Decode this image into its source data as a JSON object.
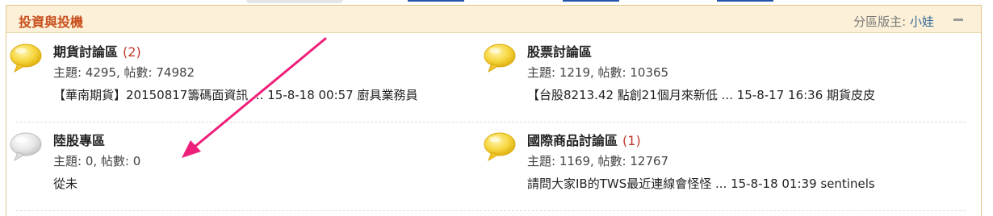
{
  "section": {
    "title": "投資與投機",
    "moderator_label": "分區版主:",
    "moderator_name": "小娃"
  },
  "forums": [
    {
      "name": "期貨討論區",
      "new_count": "(2)",
      "stats": "主題: 4295, 帖數: 74982",
      "last_post": "【華南期貨】20150817籌碼面資訊 ... 15-8-18 00:57 廚具業務員",
      "icon": "speech-bubble-new-icon"
    },
    {
      "name": "股票討論區",
      "new_count": "",
      "stats": "主題: 1219, 帖數: 10365",
      "last_post": "【台股8213.42 點創21個月來新低 ... 15-8-17 16:36 期貨皮皮",
      "icon": "speech-bubble-new-icon"
    },
    {
      "name": "陸股專區",
      "new_count": "",
      "stats": "主題: 0, 帖數: 0",
      "last_post": "從未",
      "icon": "speech-bubble-empty-icon"
    },
    {
      "name": "國際商品討論區",
      "new_count": "(1)",
      "stats": "主題: 1169, 帖數: 12767",
      "last_post": "請問大家IB的TWS最近連線會怪怪 ... 15-8-18 01:39 sentinels",
      "icon": "speech-bubble-new-icon"
    }
  ],
  "colors": {
    "section_title": "#c84f1d",
    "new_count": "#c0392b",
    "header_bg": "#fcf1d8",
    "border": "#e3c48a",
    "annotation_arrow": "#ee1f7a",
    "bubble_new": "#f7d742",
    "bubble_empty": "#e2e2e2"
  }
}
